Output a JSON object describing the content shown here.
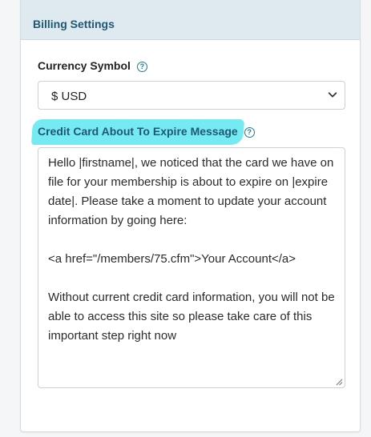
{
  "card": {
    "title": "Billing Settings"
  },
  "currency": {
    "label": "Currency Symbol",
    "help_icon": "question-circle-icon",
    "selected": "$ USD"
  },
  "expire_message": {
    "label": "Credit Card About To Expire Message",
    "help_icon": "question-circle-icon",
    "highlight_color": "#5ee6f0",
    "value": "Hello |firstname|, we noticed that the card we have on file for your membership is about to expire on |expire date|. Please take a moment to update your account information by going here:\n\n<a href=\"/members/75.cfm\">Your Account</a>\n\nWithout current credit card information, you will not be able to access this site so please take care of this important step right now"
  },
  "colors": {
    "header_bg": "#dfe9f0",
    "header_text": "#1f5870"
  }
}
